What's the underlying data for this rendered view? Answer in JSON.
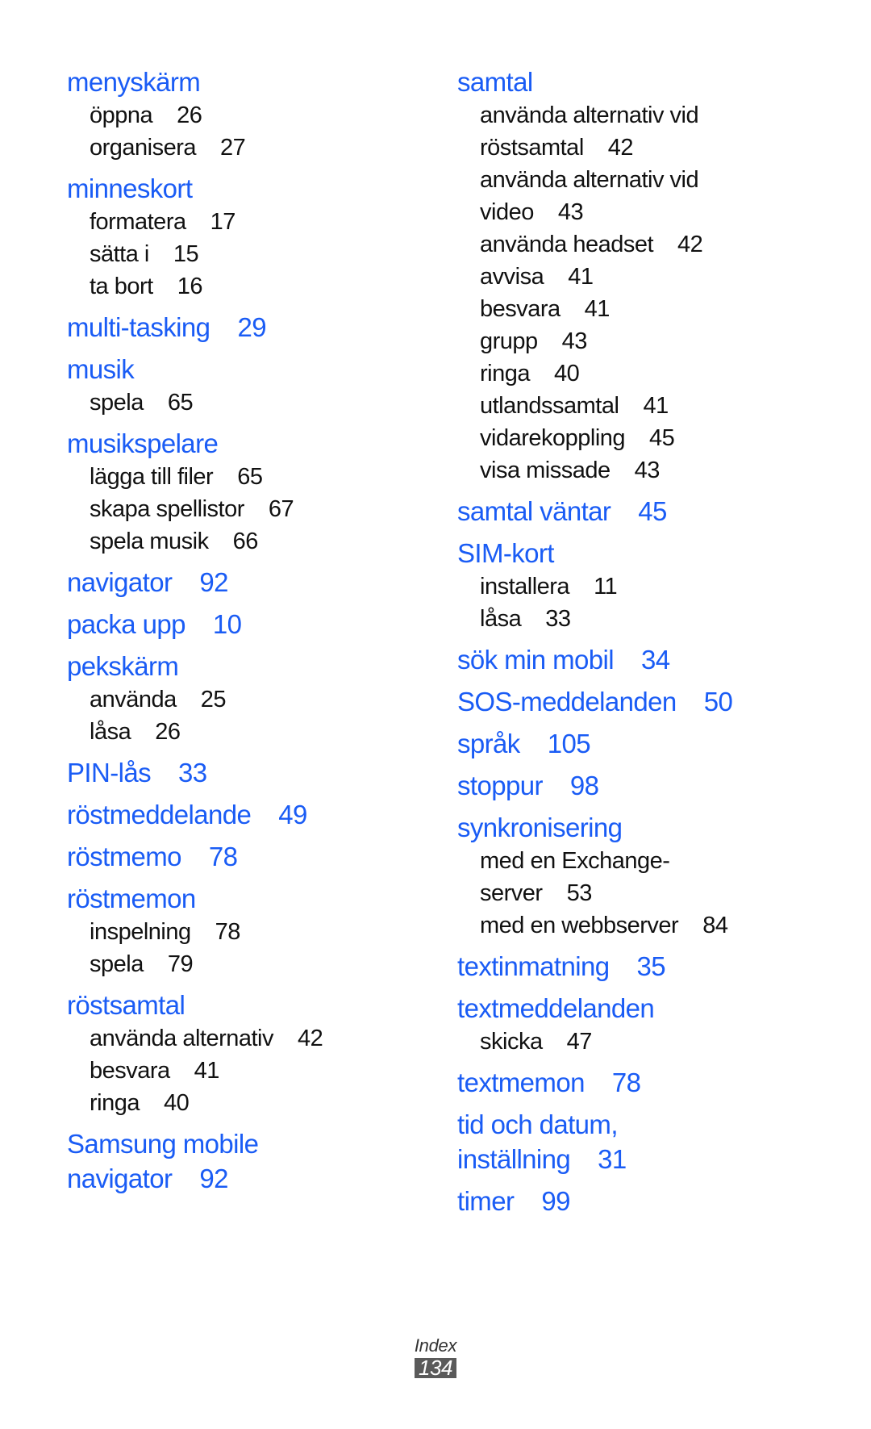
{
  "colors": {
    "heading": "#1a5cf5",
    "subentry": "#111111",
    "page_badge_bg": "#5a5a5a"
  },
  "index": {
    "left_column": [
      {
        "lines": [
          "menyskärm"
        ],
        "page": "",
        "subs": [
          {
            "lines": [
              "öppna"
            ],
            "page": "26"
          },
          {
            "lines": [
              "organisera"
            ],
            "page": "27"
          }
        ]
      },
      {
        "lines": [
          "minneskort"
        ],
        "page": "",
        "subs": [
          {
            "lines": [
              "formatera"
            ],
            "page": "17"
          },
          {
            "lines": [
              "sätta i"
            ],
            "page": "15"
          },
          {
            "lines": [
              "ta bort"
            ],
            "page": "16"
          }
        ]
      },
      {
        "lines": [
          "multi-tasking"
        ],
        "page": "29",
        "subs": []
      },
      {
        "lines": [
          "musik"
        ],
        "page": "",
        "subs": [
          {
            "lines": [
              "spela"
            ],
            "page": "65"
          }
        ]
      },
      {
        "lines": [
          "musikspelare"
        ],
        "page": "",
        "subs": [
          {
            "lines": [
              "lägga till filer"
            ],
            "page": "65"
          },
          {
            "lines": [
              "skapa spellistor"
            ],
            "page": "67"
          },
          {
            "lines": [
              "spela musik"
            ],
            "page": "66"
          }
        ]
      },
      {
        "lines": [
          "navigator"
        ],
        "page": "92",
        "subs": []
      },
      {
        "lines": [
          "packa upp"
        ],
        "page": "10",
        "subs": []
      },
      {
        "lines": [
          "pekskärm"
        ],
        "page": "",
        "subs": [
          {
            "lines": [
              "använda"
            ],
            "page": "25"
          },
          {
            "lines": [
              "låsa"
            ],
            "page": "26"
          }
        ]
      },
      {
        "lines": [
          "PIN-lås"
        ],
        "page": "33",
        "subs": []
      },
      {
        "lines": [
          "röstmeddelande"
        ],
        "page": "49",
        "subs": []
      },
      {
        "lines": [
          "röstmemo"
        ],
        "page": "78",
        "subs": []
      },
      {
        "lines": [
          "röstmemon"
        ],
        "page": "",
        "subs": [
          {
            "lines": [
              "inspelning"
            ],
            "page": "78"
          },
          {
            "lines": [
              "spela"
            ],
            "page": "79"
          }
        ]
      },
      {
        "lines": [
          "röstsamtal"
        ],
        "page": "",
        "subs": [
          {
            "lines": [
              "använda alternativ"
            ],
            "page": "42"
          },
          {
            "lines": [
              "besvara"
            ],
            "page": "41"
          },
          {
            "lines": [
              "ringa"
            ],
            "page": "40"
          }
        ]
      },
      {
        "lines": [
          "Samsung mobile",
          "navigator"
        ],
        "page": "92",
        "subs": []
      }
    ],
    "right_column": [
      {
        "lines": [
          "samtal"
        ],
        "page": "",
        "subs": [
          {
            "lines": [
              "använda alternativ vid",
              "röstsamtal"
            ],
            "page": "42"
          },
          {
            "lines": [
              "använda alternativ vid",
              "video"
            ],
            "page": "43"
          },
          {
            "lines": [
              "använda headset"
            ],
            "page": "42"
          },
          {
            "lines": [
              "avvisa"
            ],
            "page": "41"
          },
          {
            "lines": [
              "besvara"
            ],
            "page": "41"
          },
          {
            "lines": [
              "grupp"
            ],
            "page": "43"
          },
          {
            "lines": [
              "ringa"
            ],
            "page": "40"
          },
          {
            "lines": [
              "utlandssamtal"
            ],
            "page": "41"
          },
          {
            "lines": [
              "vidarekoppling"
            ],
            "page": "45"
          },
          {
            "lines": [
              "visa missade"
            ],
            "page": "43"
          }
        ]
      },
      {
        "lines": [
          "samtal väntar"
        ],
        "page": "45",
        "subs": []
      },
      {
        "lines": [
          "SIM-kort"
        ],
        "page": "",
        "subs": [
          {
            "lines": [
              "installera"
            ],
            "page": "11"
          },
          {
            "lines": [
              "låsa"
            ],
            "page": "33"
          }
        ]
      },
      {
        "lines": [
          "sök min mobil"
        ],
        "page": "34",
        "subs": []
      },
      {
        "lines": [
          "SOS-meddelanden"
        ],
        "page": "50",
        "subs": []
      },
      {
        "lines": [
          "språk"
        ],
        "page": "105",
        "subs": []
      },
      {
        "lines": [
          "stoppur"
        ],
        "page": "98",
        "subs": []
      },
      {
        "lines": [
          "synkronisering"
        ],
        "page": "",
        "subs": [
          {
            "lines": [
              "med en Exchange-",
              "server"
            ],
            "page": "53"
          },
          {
            "lines": [
              "med en webbserver"
            ],
            "page": "84"
          }
        ]
      },
      {
        "lines": [
          "textinmatning"
        ],
        "page": "35",
        "subs": []
      },
      {
        "lines": [
          "textmeddelanden"
        ],
        "page": "",
        "subs": [
          {
            "lines": [
              "skicka"
            ],
            "page": "47"
          }
        ]
      },
      {
        "lines": [
          "textmemon"
        ],
        "page": "78",
        "subs": []
      },
      {
        "lines": [
          "tid och datum,",
          "inställning"
        ],
        "page": "31",
        "subs": []
      },
      {
        "lines": [
          "timer"
        ],
        "page": "99",
        "subs": []
      }
    ]
  },
  "footer": {
    "section": "Index",
    "page_number": "134"
  }
}
